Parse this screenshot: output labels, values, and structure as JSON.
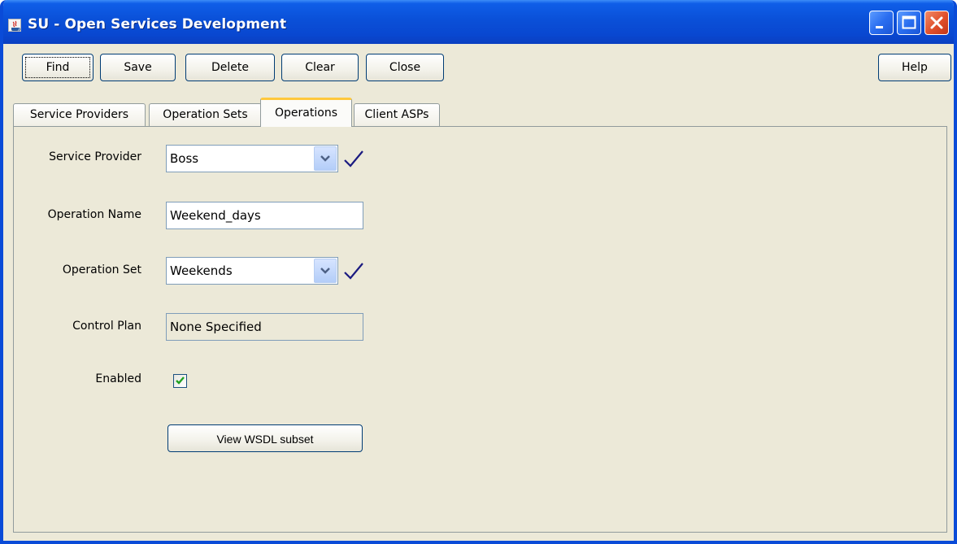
{
  "window": {
    "title": "SU - Open Services Development"
  },
  "toolbar": {
    "find": "Find",
    "save": "Save",
    "delete": "Delete",
    "clear": "Clear",
    "close": "Close",
    "help": "Help"
  },
  "tabs": [
    {
      "label": "Service Providers"
    },
    {
      "label": "Operation Sets"
    },
    {
      "label": "Operations",
      "active": true
    },
    {
      "label": "Client ASPs"
    }
  ],
  "form": {
    "service_provider": {
      "label": "Service Provider",
      "value": "Boss"
    },
    "operation_name": {
      "label": "Operation Name",
      "value": "Weekend_days"
    },
    "operation_set": {
      "label": "Operation Set",
      "value": "Weekends"
    },
    "control_plan": {
      "label": "Control Plan",
      "value": "None Specified"
    },
    "enabled": {
      "label": "Enabled",
      "checked": true
    },
    "wsdl_button": "View WSDL subset"
  },
  "colors": {
    "titlebar": "#0a50d8",
    "panel_bg": "#ece9d8",
    "active_tab_accent": "#ffc83c",
    "valid_check": "#1a1a80"
  }
}
